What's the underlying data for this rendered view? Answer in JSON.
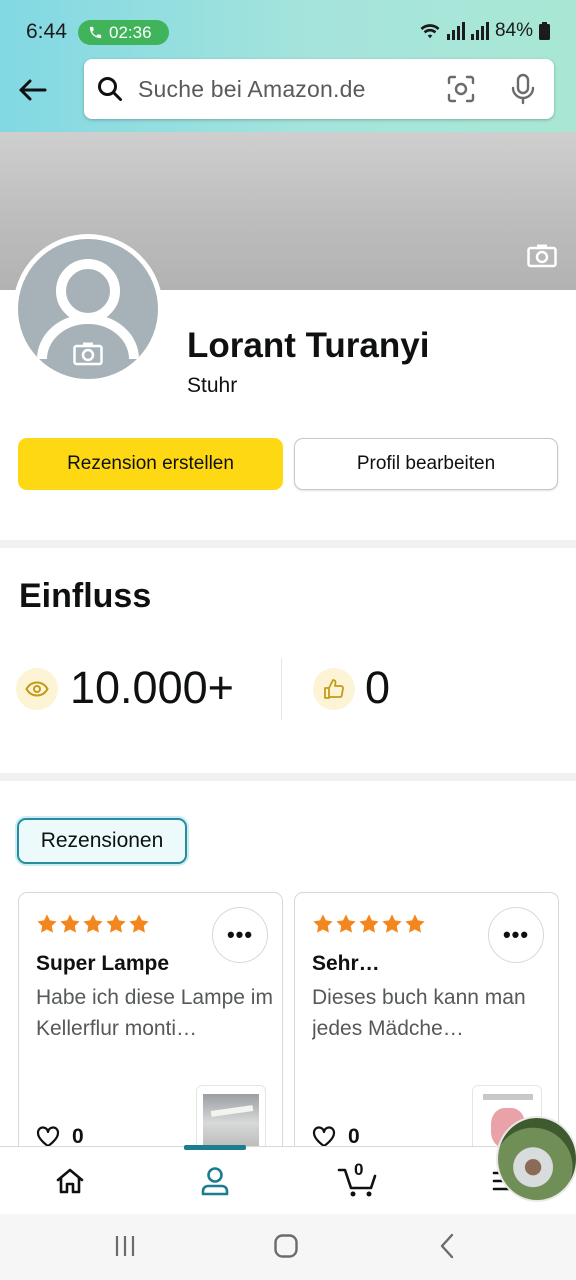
{
  "status_bar": {
    "time": "6:44",
    "call_timer": "02:36",
    "battery": "84%"
  },
  "search": {
    "placeholder": "Suche bei Amazon.de"
  },
  "profile": {
    "name": "Lorant Turanyi",
    "location": "Stuhr"
  },
  "actions": {
    "primary_label": "Rezension erstellen",
    "secondary_label": "Profil bearbeiten"
  },
  "influence": {
    "title": "Einfluss",
    "views": "10.000+",
    "likes": "0"
  },
  "tabs": {
    "active_label": "Rezensionen"
  },
  "reviews": [
    {
      "title": "Super Lampe",
      "body": "Habe ich diese Lampe im Kellerflur montiert",
      "body_display": "Habe ich diese Lampe im Kellerflur monti…",
      "rating": 5,
      "likes": "0"
    },
    {
      "title": "Sehr…",
      "body": "Dieses buch kann man jedes Mädche…",
      "body_display": "Dieses buch kann man jedes Mädche…",
      "rating": 5,
      "likes": "0"
    }
  ],
  "bottom_nav": {
    "cart_count": "0",
    "active": "profile"
  },
  "colors": {
    "header_start": "#82d8e3",
    "header_end": "#a9e7d4",
    "primary_button": "#ffd814",
    "accent": "#1b7d8f",
    "star": "#f3871d"
  },
  "icons": {
    "back": "arrow-left-icon",
    "search": "search-icon",
    "lens": "camera-lens-icon",
    "mic": "microphone-icon",
    "camera": "camera-icon",
    "views": "eye-icon",
    "likes": "thumbs-up-icon",
    "heart": "heart-icon",
    "home": "home-icon",
    "profile": "user-icon",
    "cart": "cart-icon",
    "menu": "menu-icon"
  }
}
